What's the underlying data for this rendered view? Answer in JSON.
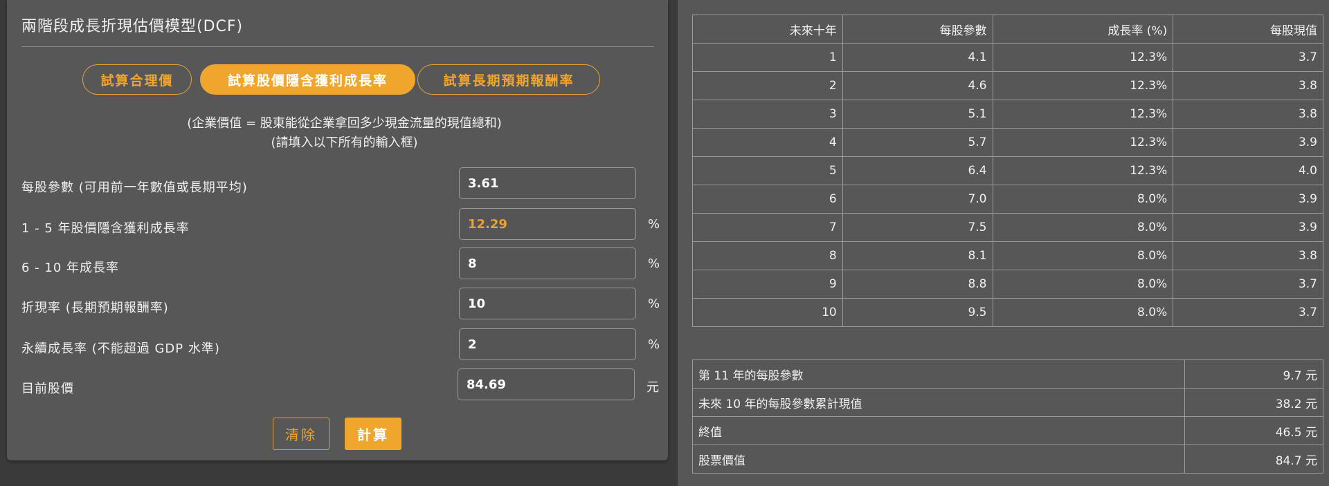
{
  "calculator": {
    "title": "兩階段成長折現估價模型(DCF)",
    "modes": [
      "試算合理價",
      "試算股價隱含獲利成長率",
      "試算長期預期報酬率"
    ],
    "active_mode": "試算股價隱含獲利成長率",
    "note_line1": "(企業價值 = 股東能從企業拿回多少現金流量的現值總和)",
    "note_line2": "(請填入以下所有的輸入框)",
    "fields": [
      {
        "label": "每股參數 (可用前一年數值或長期平均)",
        "value": "3.61",
        "unit": ""
      },
      {
        "label": "1 - 5 年股價隱含獲利成長率",
        "value": "12.29",
        "unit": "%"
      },
      {
        "label": "6 - 10 年成長率",
        "value": "8",
        "unit": "%"
      },
      {
        "label": "折現率 (長期預期報酬率)",
        "value": "10",
        "unit": "%"
      },
      {
        "label": "永續成長率 (不能超過 GDP 水準)",
        "value": "2",
        "unit": "%"
      },
      {
        "label": "目前股價",
        "value": "84.69",
        "unit": "元"
      }
    ],
    "clear_label": "清除",
    "calc_label": "計算"
  },
  "projection": {
    "headers": [
      "未來十年",
      "每股參數",
      "成長率 (%)",
      "每股現值"
    ],
    "rows": [
      [
        "1",
        "4.1",
        "12.3%",
        "3.7"
      ],
      [
        "2",
        "4.6",
        "12.3%",
        "3.8"
      ],
      [
        "3",
        "5.1",
        "12.3%",
        "3.8"
      ],
      [
        "4",
        "5.7",
        "12.3%",
        "3.9"
      ],
      [
        "5",
        "6.4",
        "12.3%",
        "4.0"
      ],
      [
        "6",
        "7.0",
        "8.0%",
        "3.9"
      ],
      [
        "7",
        "7.5",
        "8.0%",
        "3.9"
      ],
      [
        "8",
        "8.1",
        "8.0%",
        "3.8"
      ],
      [
        "9",
        "8.8",
        "8.0%",
        "3.7"
      ],
      [
        "10",
        "9.5",
        "8.0%",
        "3.7"
      ]
    ]
  },
  "summary": [
    {
      "label": "第 11 年的每股參數",
      "value": "9.7 元"
    },
    {
      "label": "未來 10 年的每股參數累計現值",
      "value": "38.2 元"
    },
    {
      "label": "終值",
      "value": "46.5 元"
    },
    {
      "label": "股票價值",
      "value": "84.7 元"
    }
  ],
  "colors": {
    "accent": "#f0a52c",
    "panel": "#575757",
    "background": "#3a3a3a"
  }
}
